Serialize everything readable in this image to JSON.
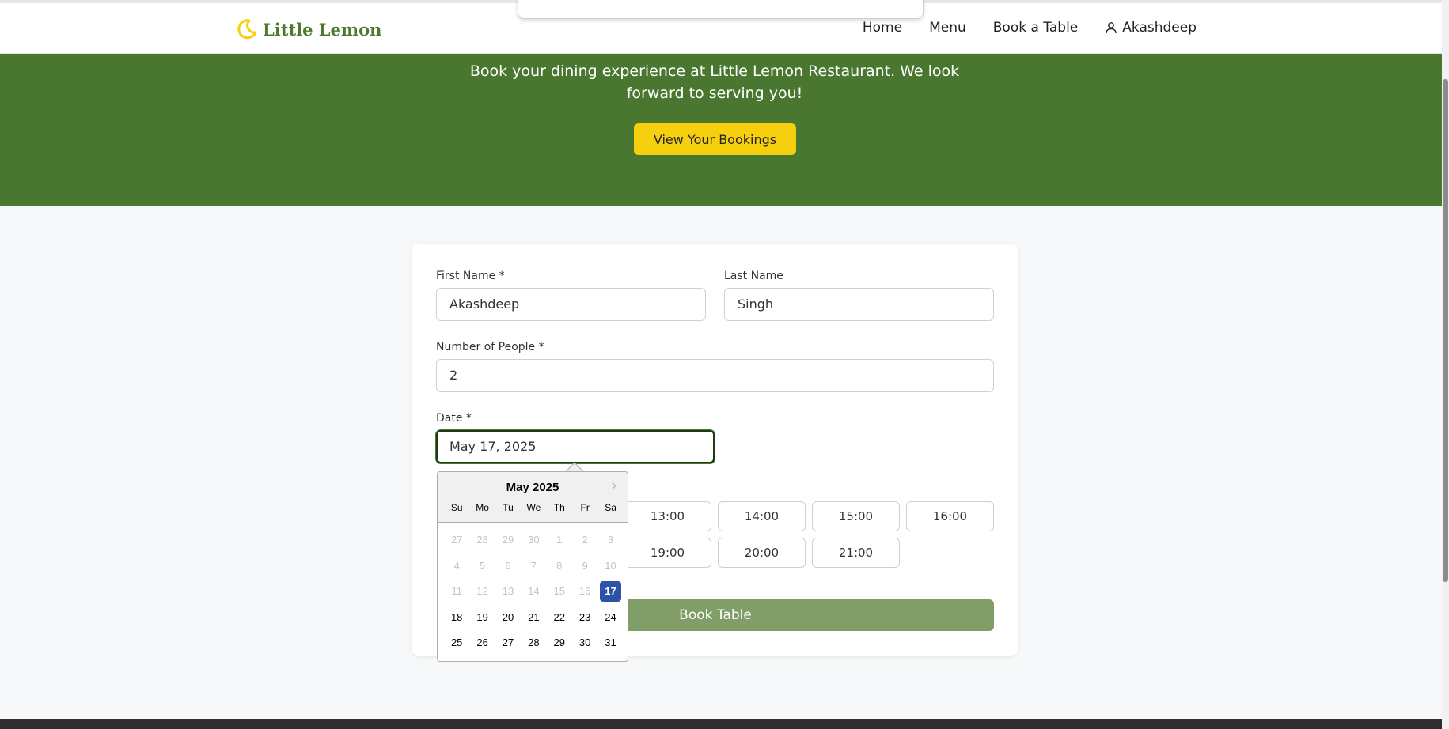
{
  "brand": {
    "name": "Little Lemon",
    "accent": "#f6cf0e",
    "green": "#4a772f"
  },
  "nav": {
    "items": [
      "Home",
      "Menu",
      "Book a Table"
    ],
    "user": "Akashdeep"
  },
  "hero": {
    "text": "Book your dining experience at Little Lemon Restaurant. We look forward to serving you!",
    "button": "View Your Bookings"
  },
  "form": {
    "first_name": {
      "label": "First Name *",
      "value": "Akashdeep"
    },
    "last_name": {
      "label": "Last Name",
      "value": "Singh"
    },
    "people": {
      "label": "Number of People *",
      "value": "2"
    },
    "date": {
      "label": "Date *",
      "value": "May 17, 2025"
    },
    "times_row1": [
      "13:00",
      "14:00",
      "15:00",
      "16:00"
    ],
    "times_row2": [
      "19:00",
      "20:00",
      "21:00"
    ],
    "submit": "Book Table"
  },
  "datepicker": {
    "month": "May 2025",
    "dow": [
      "Su",
      "Mo",
      "Tu",
      "We",
      "Th",
      "Fr",
      "Sa"
    ],
    "weeks": [
      [
        "27",
        "28",
        "29",
        "30",
        "1",
        "2",
        "3"
      ],
      [
        "4",
        "5",
        "6",
        "7",
        "8",
        "9",
        "10"
      ],
      [
        "11",
        "12",
        "13",
        "14",
        "15",
        "16",
        "17"
      ],
      [
        "18",
        "19",
        "20",
        "21",
        "22",
        "23",
        "24"
      ],
      [
        "25",
        "26",
        "27",
        "28",
        "29",
        "30",
        "31"
      ]
    ],
    "disabled_until_index": 20,
    "selected": "17"
  }
}
